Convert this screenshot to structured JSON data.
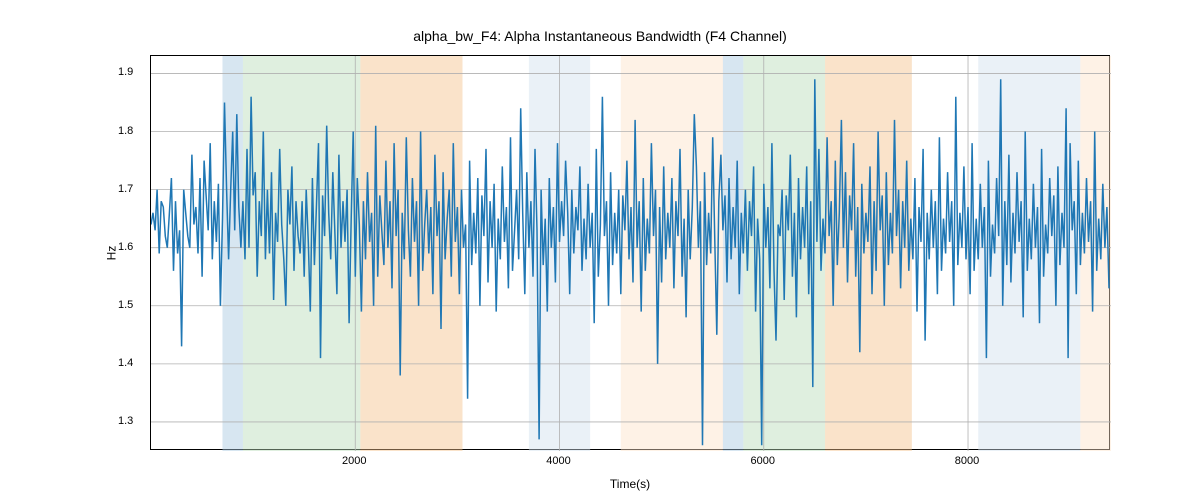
{
  "chart_data": {
    "type": "line",
    "title": "alpha_bw_F4: Alpha Instantaneous Bandwidth (F4 Channel)",
    "xlabel": "Time(s)",
    "ylabel": "Hz",
    "xlim": [
      0,
      9400
    ],
    "ylim": [
      1.25,
      1.93
    ],
    "x_ticks": [
      2000,
      4000,
      6000,
      8000
    ],
    "y_ticks": [
      1.3,
      1.4,
      1.5,
      1.6,
      1.7,
      1.8,
      1.9
    ],
    "span_regions": [
      {
        "x0": 700,
        "x1": 900,
        "color": "#a6c8e0"
      },
      {
        "x0": 900,
        "x1": 2050,
        "color": "#b8dcb8"
      },
      {
        "x0": 2050,
        "x1": 3050,
        "color": "#f5c08a"
      },
      {
        "x0": 3700,
        "x1": 4300,
        "color": "#d0dfee"
      },
      {
        "x0": 4600,
        "x1": 5600,
        "color": "#fce3c8"
      },
      {
        "x0": 5600,
        "x1": 5800,
        "color": "#a6c8e0"
      },
      {
        "x0": 5800,
        "x1": 6600,
        "color": "#b8dcb8"
      },
      {
        "x0": 6600,
        "x1": 7450,
        "color": "#f5c08a"
      },
      {
        "x0": 8100,
        "x1": 9100,
        "color": "#d0dfee"
      },
      {
        "x0": 9100,
        "x1": 9400,
        "color": "#fce3c8"
      }
    ],
    "series": [
      {
        "name": "alpha_bw_F4",
        "x_step": 20,
        "x_start": 0,
        "values": [
          1.64,
          1.66,
          1.63,
          1.7,
          1.59,
          1.68,
          1.67,
          1.62,
          1.6,
          1.66,
          1.72,
          1.56,
          1.68,
          1.59,
          1.63,
          1.43,
          1.7,
          1.66,
          1.62,
          1.6,
          1.76,
          1.64,
          1.67,
          1.59,
          1.72,
          1.55,
          1.75,
          1.69,
          1.63,
          1.78,
          1.58,
          1.68,
          1.61,
          1.71,
          1.5,
          1.65,
          1.85,
          1.7,
          1.58,
          1.7,
          1.8,
          1.63,
          1.83,
          1.67,
          1.6,
          1.68,
          1.58,
          1.77,
          1.6,
          1.86,
          1.69,
          1.73,
          1.55,
          1.68,
          1.62,
          1.8,
          1.58,
          1.7,
          1.59,
          1.73,
          1.51,
          1.66,
          1.61,
          1.77,
          1.64,
          1.58,
          1.5,
          1.7,
          1.64,
          1.74,
          1.56,
          1.68,
          1.62,
          1.59,
          1.68,
          1.55,
          1.7,
          1.61,
          1.49,
          1.72,
          1.57,
          1.67,
          1.78,
          1.41,
          1.69,
          1.62,
          1.81,
          1.66,
          1.58,
          1.73,
          1.63,
          1.52,
          1.76,
          1.6,
          1.68,
          1.61,
          1.7,
          1.47,
          1.65,
          1.8,
          1.55,
          1.72,
          1.64,
          1.49,
          1.68,
          1.58,
          1.73,
          1.61,
          1.66,
          1.5,
          1.81,
          1.55,
          1.69,
          1.63,
          1.57,
          1.75,
          1.6,
          1.68,
          1.53,
          1.78,
          1.62,
          1.7,
          1.38,
          1.66,
          1.58,
          1.79,
          1.63,
          1.55,
          1.72,
          1.61,
          1.68,
          1.5,
          1.8,
          1.56,
          1.64,
          1.7,
          1.59,
          1.67,
          1.52,
          1.76,
          1.62,
          1.68,
          1.46,
          1.73,
          1.58,
          1.65,
          1.7,
          1.55,
          1.78,
          1.61,
          1.67,
          1.52,
          1.7,
          1.6,
          1.64,
          1.34,
          1.75,
          1.57,
          1.66,
          1.59,
          1.72,
          1.5,
          1.69,
          1.62,
          1.77,
          1.54,
          1.68,
          1.6,
          1.71,
          1.49,
          1.65,
          1.58,
          1.74,
          1.61,
          1.67,
          1.53,
          1.79,
          1.56,
          1.63,
          1.7,
          1.58,
          1.84,
          1.66,
          1.52,
          1.73,
          1.6,
          1.68,
          1.55,
          1.77,
          1.63,
          1.27,
          1.7,
          1.57,
          1.65,
          1.49,
          1.72,
          1.6,
          1.67,
          1.54,
          1.78,
          1.61,
          1.68,
          1.62,
          1.75,
          1.66,
          1.52,
          1.7,
          1.59,
          1.67,
          1.63,
          1.74,
          1.56,
          1.65,
          1.58,
          1.71,
          1.6,
          1.66,
          1.47,
          1.77,
          1.55,
          1.64,
          1.86,
          1.62,
          1.68,
          1.5,
          1.73,
          1.57,
          1.66,
          1.59,
          1.7,
          1.52,
          1.69,
          1.63,
          1.75,
          1.58,
          1.67,
          1.54,
          1.82,
          1.6,
          1.68,
          1.49,
          1.72,
          1.56,
          1.65,
          1.59,
          1.78,
          1.62,
          1.7,
          1.4,
          1.67,
          1.54,
          1.74,
          1.58,
          1.66,
          1.6,
          1.72,
          1.53,
          1.68,
          1.62,
          1.77,
          1.55,
          1.65,
          1.48,
          1.7,
          1.58,
          1.67,
          1.83,
          1.74,
          1.6,
          1.68,
          1.26,
          1.73,
          1.57,
          1.66,
          1.59,
          1.79,
          1.62,
          1.45,
          1.68,
          1.76,
          1.63,
          1.69,
          1.54,
          1.72,
          1.58,
          1.67,
          1.6,
          1.75,
          1.52,
          1.66,
          1.59,
          1.7,
          1.56,
          1.68,
          1.62,
          1.74,
          1.49,
          1.65,
          1.58,
          1.26,
          1.71,
          1.6,
          1.67,
          1.53,
          1.78,
          1.56,
          1.44,
          1.64,
          1.62,
          1.7,
          1.51,
          1.69,
          1.63,
          1.76,
          1.55,
          1.66,
          1.48,
          1.72,
          1.58,
          1.67,
          1.6,
          1.74,
          1.52,
          1.68,
          1.36,
          1.89,
          1.61,
          1.77,
          1.56,
          1.65,
          1.59,
          1.79,
          1.62,
          1.68,
          1.5,
          1.75,
          1.57,
          1.66,
          1.82,
          1.6,
          1.73,
          1.54,
          1.69,
          1.63,
          1.78,
          1.55,
          1.67,
          1.42,
          1.71,
          1.59,
          1.66,
          1.61,
          1.74,
          1.52,
          1.68,
          1.56,
          1.8,
          1.63,
          1.69,
          1.5,
          1.73,
          1.57,
          1.66,
          1.59,
          1.82,
          1.62,
          1.7,
          1.53,
          1.68,
          1.6,
          1.75,
          1.56,
          1.65,
          1.58,
          1.72,
          1.49,
          1.67,
          1.61,
          1.77,
          1.44,
          1.66,
          1.58,
          1.7,
          1.6,
          1.68,
          1.52,
          1.79,
          1.56,
          1.65,
          1.59,
          1.73,
          1.61,
          1.68,
          1.5,
          1.86,
          1.57,
          1.66,
          1.6,
          1.74,
          1.58,
          1.67,
          1.52,
          1.78,
          1.56,
          1.65,
          1.58,
          1.71,
          1.6,
          1.67,
          1.41,
          1.75,
          1.55,
          1.64,
          1.59,
          1.72,
          1.62,
          1.89,
          1.5,
          1.68,
          1.57,
          1.76,
          1.54,
          1.66,
          1.59,
          1.73,
          1.61,
          1.68,
          1.48,
          1.8,
          1.56,
          1.65,
          1.58,
          1.71,
          1.6,
          1.67,
          1.47,
          1.77,
          1.55,
          1.64,
          1.59,
          1.72,
          1.62,
          1.69,
          1.5,
          1.74,
          1.57,
          1.66,
          1.6,
          1.84,
          1.41,
          1.78,
          1.63,
          1.68,
          1.52,
          1.75,
          1.57,
          1.66,
          1.59,
          1.72,
          1.61,
          1.68,
          1.49,
          1.8,
          1.56,
          1.65,
          1.58,
          1.71,
          1.6,
          1.67,
          1.53
        ]
      }
    ]
  }
}
